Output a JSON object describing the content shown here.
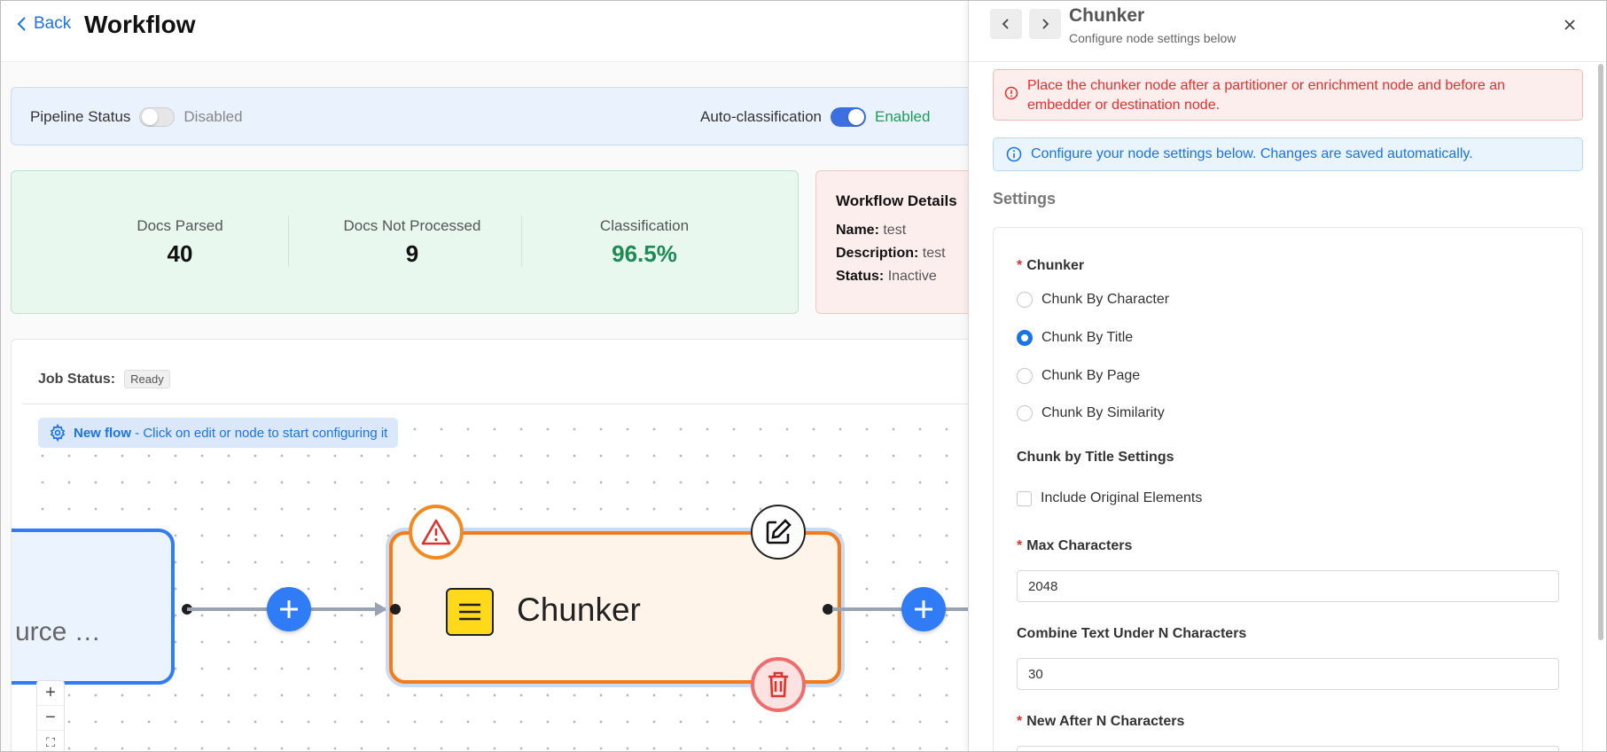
{
  "header": {
    "back_label": "Back",
    "title": "Workflow"
  },
  "pipeline": {
    "status_label": "Pipeline Status",
    "status_value": "Disabled",
    "auto_label": "Auto-classification",
    "auto_value": "Enabled"
  },
  "stats": [
    {
      "label": "Docs Parsed",
      "value": "40"
    },
    {
      "label": "Docs Not Processed",
      "value": "9"
    },
    {
      "label": "Classification",
      "value": "96.5%"
    }
  ],
  "details": {
    "heading": "Workflow Details",
    "name_label": "Name:",
    "name_value": "test",
    "description_label": "Description:",
    "description_value": "test",
    "status_label": "Status:",
    "status_value": "Inactive"
  },
  "canvas": {
    "job_status_label": "Job Status:",
    "job_status_value": "Ready",
    "hint_bold": "New flow",
    "hint_text": " - Click on edit or node to start configuring it",
    "source_node_label": "urce …",
    "chunker_node_label": "Chunker"
  },
  "panel": {
    "title": "Chunker",
    "subtitle": "Configure node settings below",
    "error_text": "Place the chunker node after a partitioner or enrichment node and before an embedder or destination node.",
    "info_text": "Configure your node settings below. Changes are saved automatically.",
    "section_title": "Settings",
    "chunker_label": "Chunker",
    "options": [
      "Chunk By Character",
      "Chunk By Title",
      "Chunk By Page",
      "Chunk By Similarity"
    ],
    "selected_option": "Chunk By Title",
    "title_settings_label": "Chunk by Title Settings",
    "include_original_label": "Include Original Elements",
    "max_chars_label": "Max Characters",
    "max_chars_value": "2048",
    "combine_label": "Combine Text Under N Characters",
    "combine_value": "30",
    "new_after_label": "New After N Characters"
  },
  "colors": {
    "accent": "#1a73e8",
    "node_blue": "#2f7cf6",
    "chunker_border": "#f47b1a",
    "error": "#e0322d",
    "success": "#1f9d55"
  }
}
